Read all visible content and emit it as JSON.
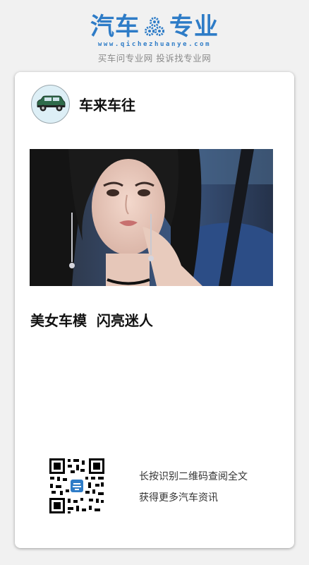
{
  "header": {
    "logo_left": "汽车",
    "logo_right": "专业",
    "logo_url": "www.qichezhuanye.com",
    "slogan": "买车问专业网 投诉找专业网",
    "brand_color": "#2e7cc7"
  },
  "author": {
    "name": "车来车往",
    "avatar_icon": "car-icon"
  },
  "article": {
    "image_icon": "photo-woman-car-model",
    "title": "美女车模  闪亮迷人"
  },
  "qr": {
    "icon": "qr-code-icon",
    "caption_line1": "长按识别二维码查阅全文",
    "caption_line2": "获得更多汽车资讯"
  }
}
